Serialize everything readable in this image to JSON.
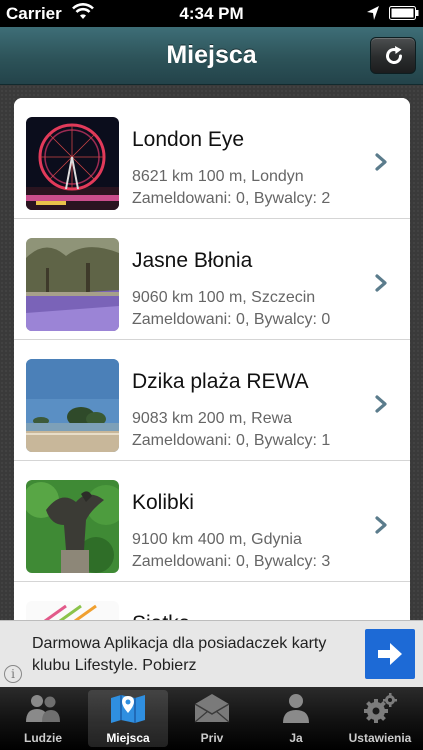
{
  "status_bar": {
    "carrier": "Carrier",
    "time": "4:34 PM"
  },
  "nav": {
    "title": "Miejsca"
  },
  "places": [
    {
      "name": "London Eye",
      "distance": "8621 km 100 m, Londyn",
      "stats": "Zameldowani: 0, Bywalcy: 2",
      "thumb": "ferris-wheel-photo"
    },
    {
      "name": "Jasne Błonia",
      "distance": "9060 km 100 m, Szczecin",
      "stats": "Zameldowani: 0, Bywalcy: 0",
      "thumb": "park-flowers-photo"
    },
    {
      "name": "Dzika plaża REWA",
      "distance": "9083 km 200 m, Rewa",
      "stats": "Zameldowani: 0, Bywalcy: 1",
      "thumb": "beach-photo"
    },
    {
      "name": "Kolibki",
      "distance": "9100 km 400 m, Gdynia",
      "stats": "Zameldowani: 0, Bywalcy: 3",
      "thumb": "eagle-statue-photo"
    },
    {
      "name": "Siatka",
      "distance": "",
      "stats": "",
      "thumb": "logo-photo"
    }
  ],
  "ad": {
    "text": "Darmowa Aplikacja dla posiadaczek karty klubu Lifestyle. Pobierz",
    "info": "i"
  },
  "tabs": [
    {
      "label": "Ludzie",
      "icon": "people-icon"
    },
    {
      "label": "Miejsca",
      "icon": "map-icon"
    },
    {
      "label": "Priv",
      "icon": "envelope-icon"
    },
    {
      "label": "Ja",
      "icon": "person-icon"
    },
    {
      "label": "Ustawienia",
      "icon": "gears-icon"
    }
  ],
  "colors": {
    "nav": "#2d5359",
    "ad_button": "#1d6ad6",
    "chevron": "#5b7c8c"
  }
}
